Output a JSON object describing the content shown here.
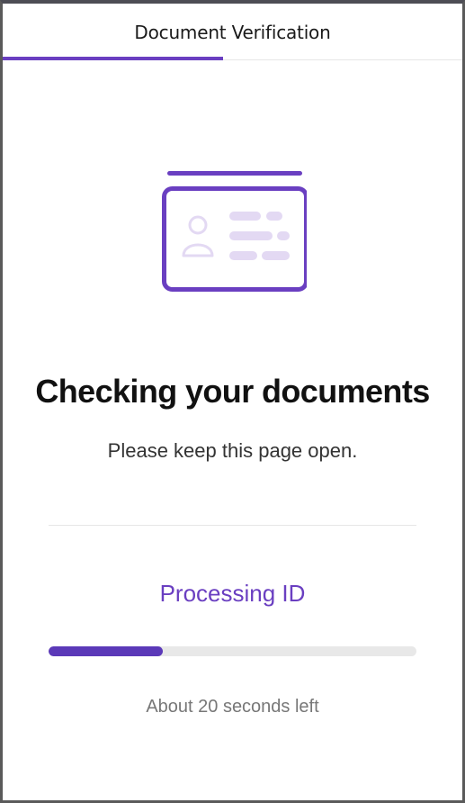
{
  "header": {
    "title": "Document Verification",
    "step_progress": 0.48
  },
  "illustration": {
    "icon": "id-card-icon",
    "accent_color": "#6a3fc1",
    "light_color": "#e3d9f3"
  },
  "main": {
    "heading": "Checking your documents",
    "subtext": "Please keep this page open."
  },
  "status": {
    "label": "Processing ID",
    "progress": 0.31,
    "eta": "About 20 seconds left",
    "accent_color": "#5b39b8"
  }
}
